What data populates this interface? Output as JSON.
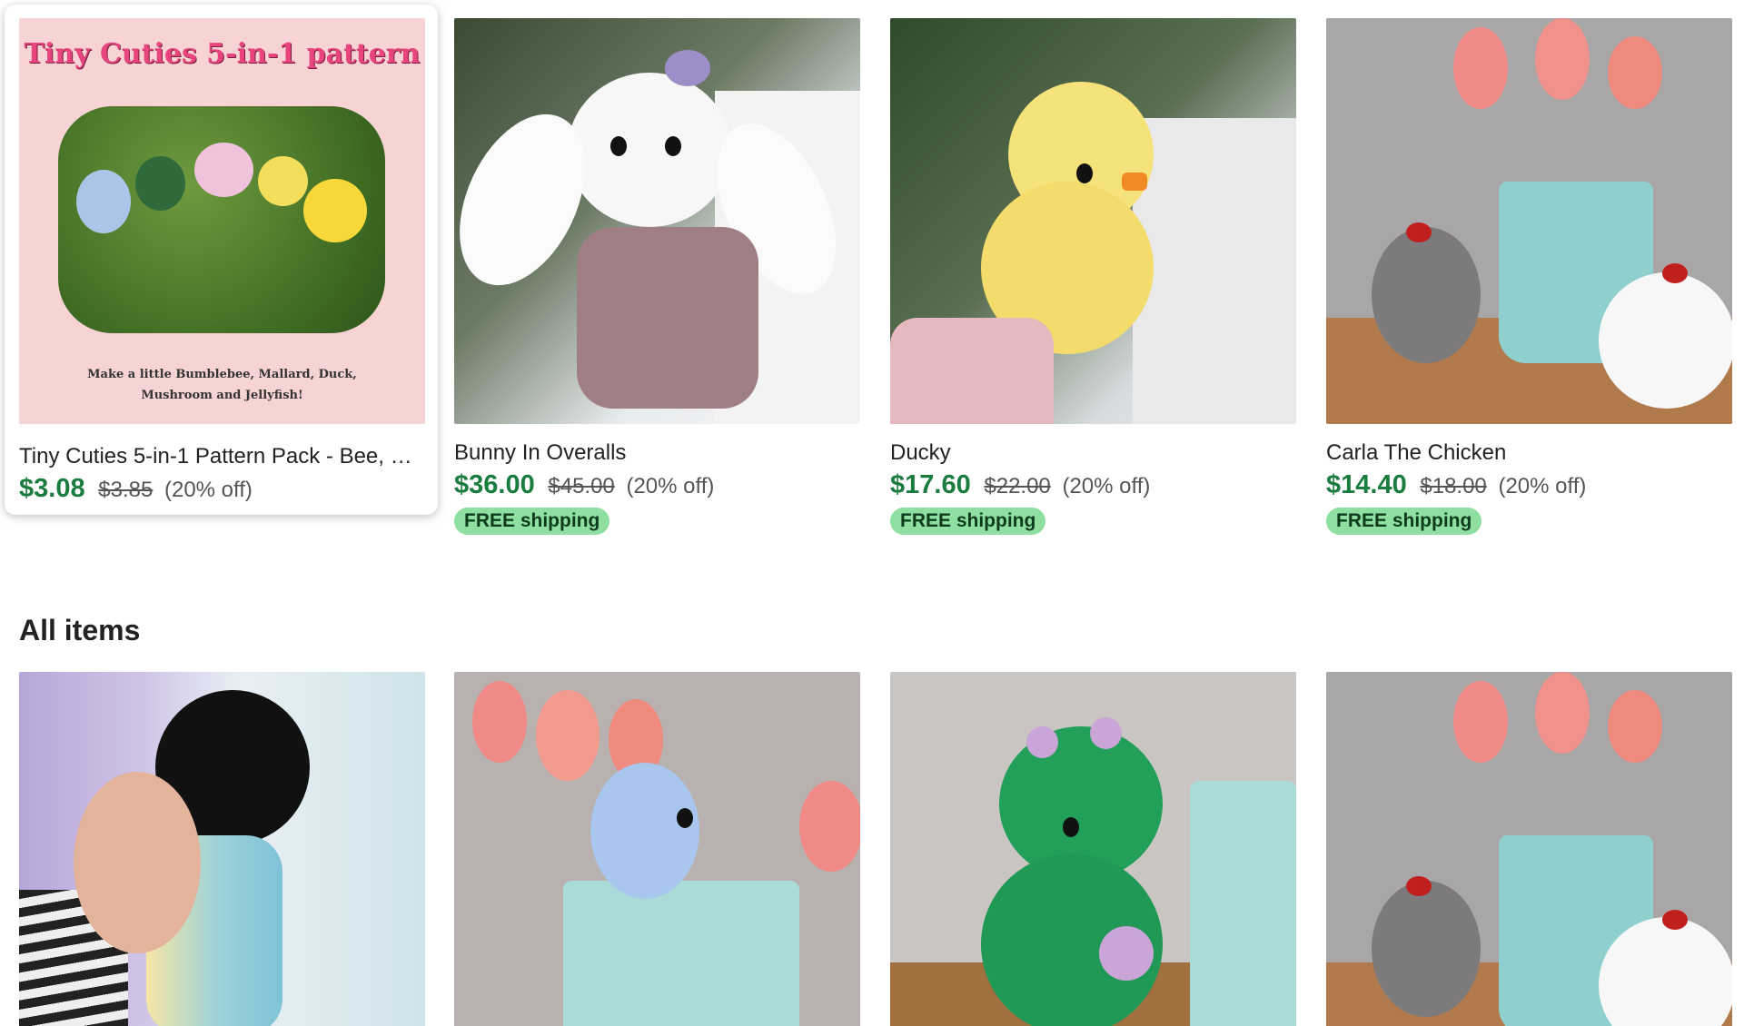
{
  "featured": [
    {
      "title": "Tiny Cuties 5-in-1 Pattern Pack - Bee, Mallard, Duck, Mushroom and Jellyfish",
      "price": "$3.08",
      "original_price": "$3.85",
      "discount": "(20% off)",
      "shipping": "",
      "image_banner": {
        "heading": "Tiny Cuties 5-in-1 pattern",
        "caption_line1": "Make a little Bumblebee, Mallard, Duck,",
        "caption_line2": "Mushroom and Jellyfish!"
      }
    },
    {
      "title": "Bunny In Overalls",
      "price": "$36.00",
      "original_price": "$45.00",
      "discount": "(20% off)",
      "shipping": "FREE shipping"
    },
    {
      "title": "Ducky",
      "price": "$17.60",
      "original_price": "$22.00",
      "discount": "(20% off)",
      "shipping": "FREE shipping"
    },
    {
      "title": "Carla The Chicken",
      "price": "$14.40",
      "original_price": "$18.00",
      "discount": "(20% off)",
      "shipping": "FREE shipping"
    }
  ],
  "section": {
    "title": "All items"
  },
  "colors": {
    "price_green": "#1a7d3f",
    "shipping_badge_bg": "#8fe0a0",
    "shipping_badge_text": "#0d3b1c",
    "pattern_banner_pink": "#f7d3d3",
    "pattern_heading_pink": "#e8457f"
  }
}
